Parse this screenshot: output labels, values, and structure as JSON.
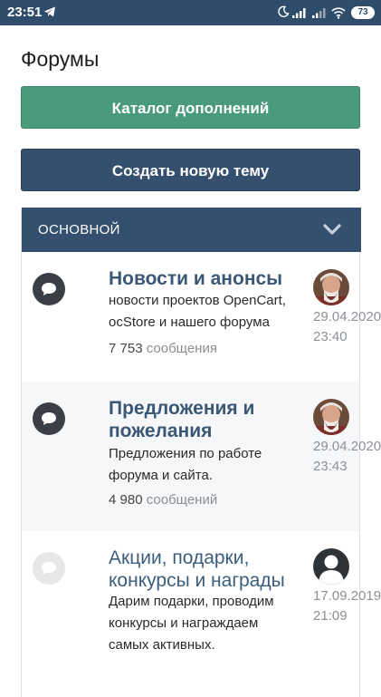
{
  "status_bar": {
    "time": "23:51",
    "battery": "73"
  },
  "page": {
    "title": "Форумы"
  },
  "buttons": {
    "catalog_label": "Каталог дополнений",
    "new_topic_label": "Создать новую тему"
  },
  "section": {
    "title": "ОСНОВНОЙ"
  },
  "forums": [
    {
      "name": "Новости и анонсы",
      "description": "новости проектов OpenCart, ocStore и нашего форума",
      "count": "7 753",
      "count_label": "сообщения",
      "date": "29.04.2020",
      "time": "23:40"
    },
    {
      "name": "Предложения и пожелания",
      "description": "Предложения по работе форума и сайта.",
      "count": "4 980",
      "count_label": "сообщений",
      "date": "29.04.2020",
      "time": "23:43"
    },
    {
      "name": "Акции, подарки, конкурсы и награды",
      "description": "Дарим подарки, проводим конкурсы и награждаем самых активных.",
      "date": "17.09.2019",
      "time": "21:09"
    }
  ],
  "colors": {
    "header": "#2f4d6b",
    "green_button": "#4a9a7c",
    "blue_button": "#35506e",
    "link": "#3a5876"
  },
  "icons": [
    "telegram-icon",
    "moon-icon",
    "signal-icon",
    "wifi-icon",
    "battery-icon",
    "chevron-down-icon",
    "chat-bubble-icon",
    "avatar"
  ]
}
